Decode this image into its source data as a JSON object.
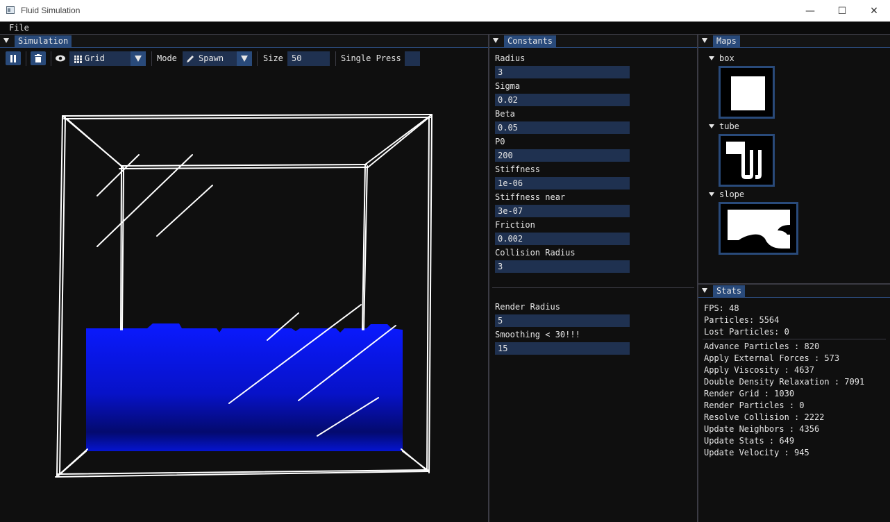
{
  "window": {
    "title": "Fluid Simulation",
    "minimize": "—",
    "maximize": "☐",
    "close": "✕"
  },
  "menu": {
    "file": "File"
  },
  "simulation": {
    "tab": "Simulation",
    "view_mode": "Grid",
    "mode_label": "Mode",
    "mode_value": "Spawn",
    "size_label": "Size",
    "size_value": "50",
    "press_label": "Single Press",
    "fluid_color": "#0a1aff",
    "icons": [
      "pause-icon",
      "trash-icon",
      "eye-icon",
      "grid-icon",
      "pencil-icon"
    ]
  },
  "constants": {
    "tab": "Constants",
    "items": [
      {
        "label": "Radius",
        "value": "3"
      },
      {
        "label": "Sigma",
        "value": "0.02"
      },
      {
        "label": "Beta",
        "value": "0.05"
      },
      {
        "label": "P0",
        "value": "200"
      },
      {
        "label": "Stiffness",
        "value": "1e-06"
      },
      {
        "label": "Stiffness near",
        "value": "3e-07"
      },
      {
        "label": "Friction",
        "value": "0.002"
      },
      {
        "label": "Collision Radius",
        "value": "3"
      }
    ],
    "render": [
      {
        "label": "Render Radius",
        "value": "5"
      },
      {
        "label": "Smoothing < 30!!!",
        "value": "15"
      }
    ]
  },
  "maps": {
    "tab": "Maps",
    "items": [
      {
        "label": "box"
      },
      {
        "label": "tube"
      },
      {
        "label": "slope"
      }
    ]
  },
  "stats": {
    "tab": "Stats",
    "fps": "FPS: 48",
    "particles": "Particles: 5564",
    "lost": "Lost Particles: 0",
    "timings": [
      "Advance Particles : 820",
      "Apply External Forces : 573",
      "Apply Viscosity : 4637",
      "Double Density Relaxation : 7091",
      "Render Grid : 1030",
      "Render Particles : 0",
      "Resolve Collision : 2222",
      "Update Neighbors : 4356",
      "Update Stats : 649",
      "Update Velocity : 945"
    ]
  }
}
